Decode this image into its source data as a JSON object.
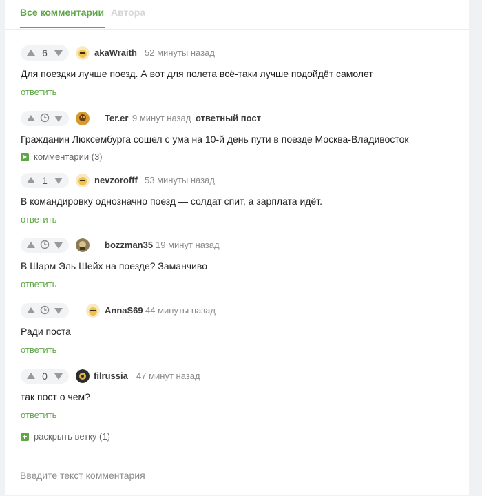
{
  "tabs": {
    "all": "Все комментарии",
    "author": "Автора"
  },
  "comments": [
    {
      "score": "6",
      "author": "akaWraith",
      "time": "52 минуты назад",
      "badge": "",
      "text": "Для поездки лучше поезд. А вот для полета всё-таки лучше подойдёт самолет",
      "action": "ответить"
    },
    {
      "score": "",
      "author": "Ter.er",
      "time": "9 минут назад",
      "badge": "ответный пост",
      "text": "Гражданин Люксембурга сошел с ума на 10-й день пути в поезде Москва-Владивосток",
      "action": "комментарии (3)"
    },
    {
      "score": "1",
      "author": "nevzorofff",
      "time": "53 минуты назад",
      "badge": "",
      "text": "В командировку однозначно поезд — солдат спит, а зарплата идёт.",
      "action": "ответить"
    },
    {
      "score": "",
      "author": "bozzman35",
      "time": "19 минут назад",
      "badge": "",
      "text": "В Шарм Эль Шейх на поезде? Заманчиво",
      "action": "ответить"
    },
    {
      "score": "",
      "author": "AnnaS69",
      "time": "44 минуты назад",
      "badge": "",
      "text": "Ради поста",
      "action": "ответить"
    },
    {
      "score": "0",
      "author": "filrussia",
      "time": "47 минут назад",
      "badge": "",
      "text": "так пост о чем?",
      "action": "ответить"
    }
  ],
  "expand_branch": "раскрыть ветку (1)",
  "comment_input": {
    "placeholder": "Введите текст комментария"
  },
  "colors": {
    "accent": "#5ea646",
    "muted": "#8b8b8b",
    "background": "#f0f1f3"
  },
  "icons": {
    "upvote": "triangle-up-icon",
    "downvote": "triangle-down-icon",
    "pending": "clock-icon",
    "comments": "play-square-icon",
    "expand": "plus-square-icon"
  }
}
